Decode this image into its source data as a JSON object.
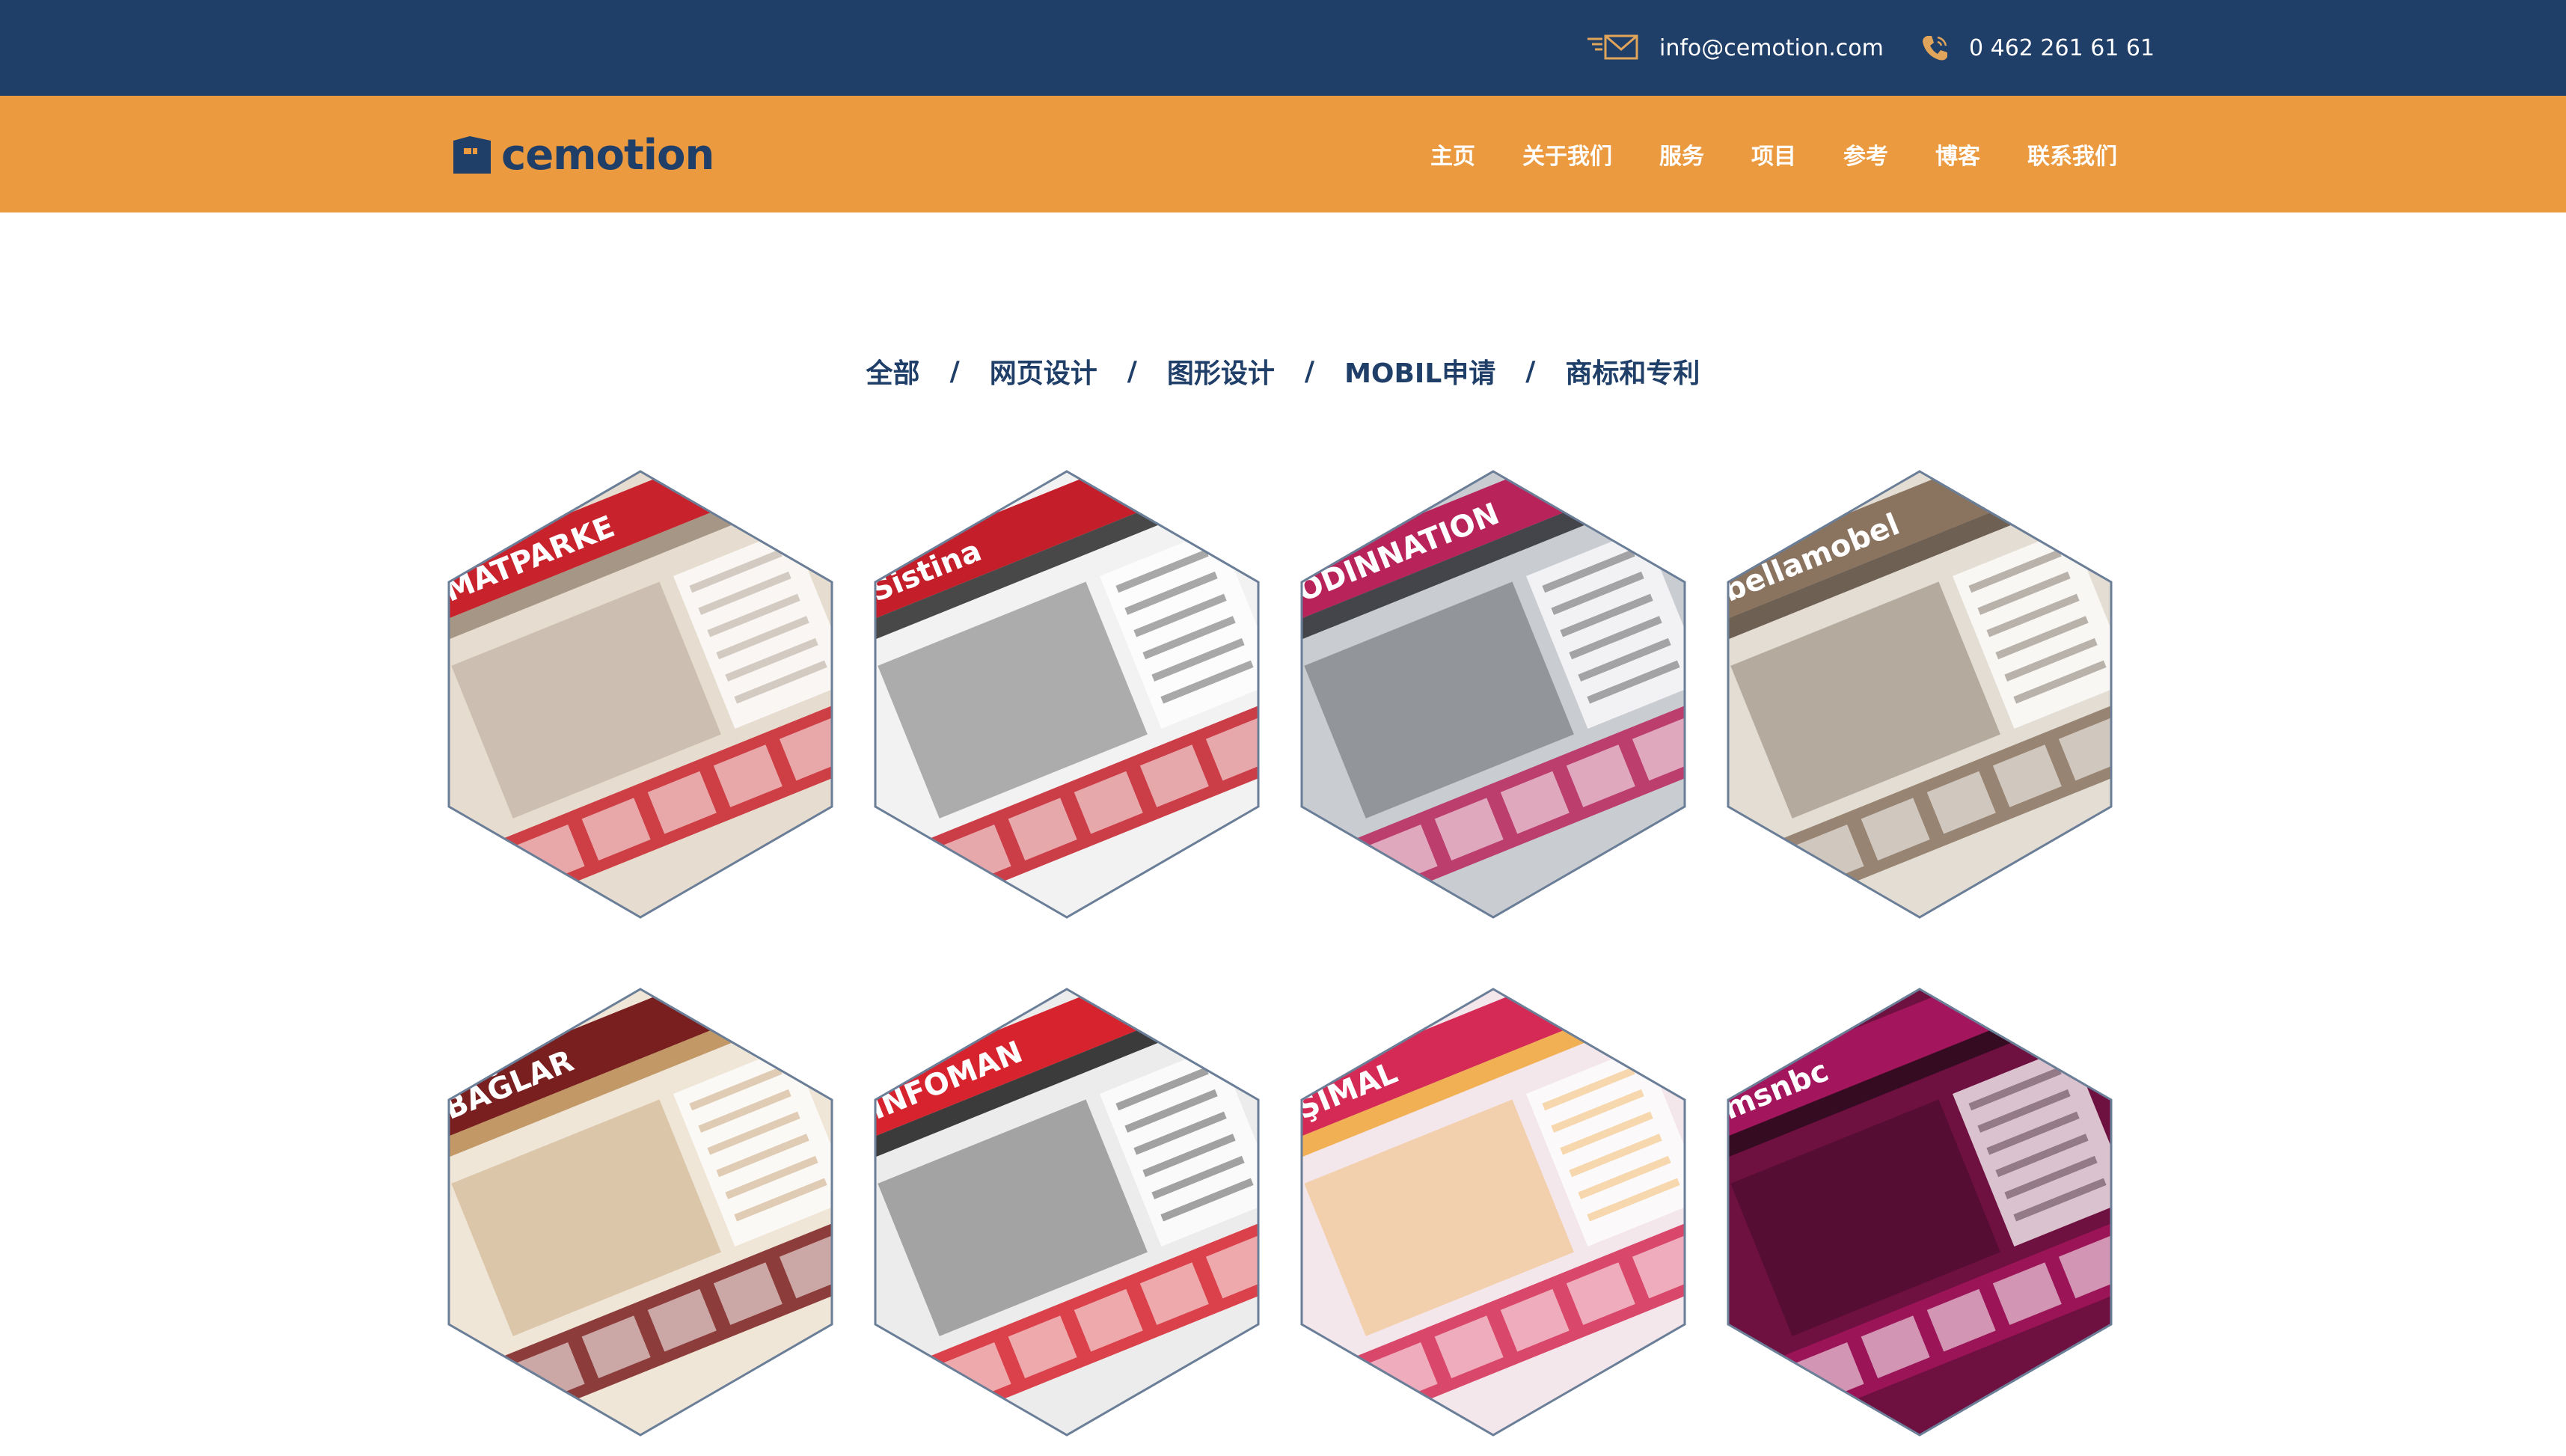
{
  "topbar": {
    "email": "info@cemotion.com",
    "phone": "0 462 261 61 61",
    "email_icon": "envelope-icon",
    "phone_icon": "phone-icon",
    "bg_color": "#1f3e68"
  },
  "header": {
    "logo_text": "cemotion",
    "bg_color": "#ec9a3f",
    "menu": [
      {
        "label": "主页"
      },
      {
        "label": "关于我们"
      },
      {
        "label": "服务"
      },
      {
        "label": "项目"
      },
      {
        "label": "参考"
      },
      {
        "label": "博客"
      },
      {
        "label": "联系我们"
      }
    ]
  },
  "filters": [
    {
      "label": "全部"
    },
    {
      "label": "网页设计"
    },
    {
      "label": "图形设计"
    },
    {
      "label": "MOBIL申请"
    },
    {
      "label": "商标和专利"
    }
  ],
  "filter_separator": "/",
  "portfolio": [
    {
      "id": "matparke",
      "caption": "MATPARKE",
      "accent": "#c8232c",
      "base": "#e6dccf",
      "dark": "#9a8978"
    },
    {
      "id": "sistina",
      "caption": "Sistina",
      "accent": "#c41e2a",
      "base": "#f2f2f2",
      "dark": "#2a2a2a"
    },
    {
      "id": "odinnation",
      "caption": "ODINNATION",
      "accent": "#b8245a",
      "base": "#c9ccd1",
      "dark": "#2c2d33"
    },
    {
      "id": "bellamobel",
      "caption": "bellamobel",
      "accent": "#8a7460",
      "base": "#e3ddd3",
      "dark": "#5b4a3d"
    },
    {
      "id": "baglar",
      "caption": "BAĞLAR",
      "accent": "#7a1f20",
      "base": "#efe6d8",
      "dark": "#b88a52"
    },
    {
      "id": "infoman",
      "caption": "INFOMAN",
      "accent": "#d7232e",
      "base": "#ececec",
      "dark": "#1c1c1c"
    },
    {
      "id": "simal",
      "caption": "ŞIMAL",
      "accent": "#d42a55",
      "base": "#f4e7ec",
      "dark": "#f0a63a"
    },
    {
      "id": "raynet",
      "caption": "msnbc",
      "accent": "#a3155c",
      "base": "#6e1040",
      "dark": "#2b0a1c"
    }
  ]
}
